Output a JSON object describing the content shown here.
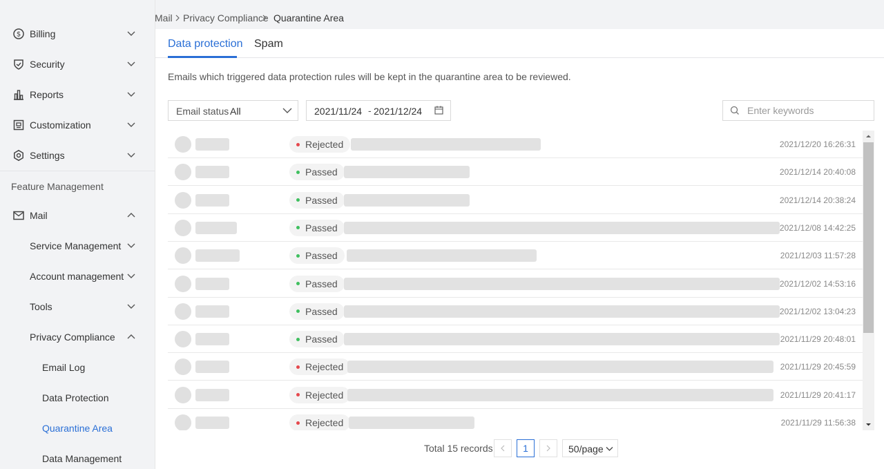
{
  "sidebar": {
    "items": [
      {
        "label": "Billing",
        "icon": "dollar-circle-icon"
      },
      {
        "label": "Security",
        "icon": "shield-icon"
      },
      {
        "label": "Reports",
        "icon": "bar-chart-icon"
      },
      {
        "label": "Customization",
        "icon": "customize-icon"
      },
      {
        "label": "Settings",
        "icon": "gear-icon"
      }
    ],
    "section_label": "Feature Management",
    "mail": {
      "label": "Mail",
      "children": [
        {
          "label": "Service Management"
        },
        {
          "label": "Account management"
        },
        {
          "label": "Tools"
        },
        {
          "label": "Privacy Compliance"
        }
      ]
    },
    "privacy_children": [
      {
        "label": "Email Log"
      },
      {
        "label": "Data Protection"
      },
      {
        "label": "Quarantine Area"
      },
      {
        "label": "Data Management"
      }
    ]
  },
  "breadcrumb": [
    "Mail",
    "Privacy Compliance",
    "Quarantine Area"
  ],
  "tabs": [
    {
      "label": "Data protection",
      "active": true
    },
    {
      "label": "Spam",
      "active": false
    }
  ],
  "description": "Emails which triggered data protection rules will be kept in the quarantine area to be reviewed.",
  "filters": {
    "status_label": "Email status",
    "status_value": "All",
    "date_start": "2021/11/24",
    "date_separator": "-",
    "date_end": "2021/12/24",
    "search_placeholder": "Enter keywords"
  },
  "colors": {
    "accent": "#2a6fd6",
    "rejected": "#e5484d",
    "passed": "#3fbf5f"
  },
  "rows": [
    {
      "status": "Rejected",
      "time": "2021/12/20 16:26:31"
    },
    {
      "status": "Passed",
      "time": "2021/12/14 20:40:08"
    },
    {
      "status": "Passed",
      "time": "2021/12/14 20:38:24"
    },
    {
      "status": "Passed",
      "time": "2021/12/08 14:42:25"
    },
    {
      "status": "Passed",
      "time": "2021/12/03 11:57:28"
    },
    {
      "status": "Passed",
      "time": "2021/12/02 14:53:16"
    },
    {
      "status": "Passed",
      "time": "2021/12/02 13:04:23"
    },
    {
      "status": "Passed",
      "time": "2021/11/29 20:48:01"
    },
    {
      "status": "Rejected",
      "time": "2021/11/29 20:45:59"
    },
    {
      "status": "Rejected",
      "time": "2021/11/29 20:41:17"
    },
    {
      "status": "Rejected",
      "time": "2021/11/29 11:56:38"
    }
  ],
  "pagination": {
    "total_text": "Total 15 records",
    "current_page": "1",
    "page_size": "50/page"
  }
}
